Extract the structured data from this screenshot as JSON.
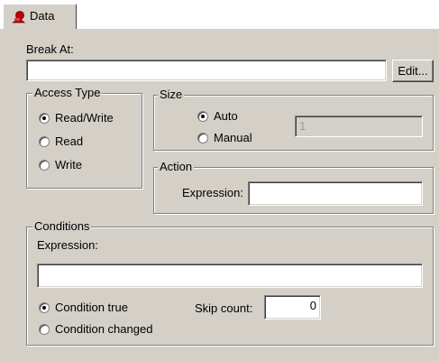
{
  "tab": {
    "label": "Data",
    "icon": "breakpoint-data-icon",
    "icon_color": "#c00000"
  },
  "break_at": {
    "label": "Break At:",
    "value": "",
    "edit_button": "Edit..."
  },
  "access_type": {
    "title": "Access Type",
    "options": [
      {
        "label": "Read/Write",
        "checked": true
      },
      {
        "label": "Read",
        "checked": false
      },
      {
        "label": "Write",
        "checked": false
      }
    ]
  },
  "size": {
    "title": "Size",
    "options": [
      {
        "label": "Auto",
        "checked": true
      },
      {
        "label": "Manual",
        "checked": false
      }
    ],
    "value": "1"
  },
  "action": {
    "title": "Action",
    "expression_label": "Expression:",
    "expression_value": ""
  },
  "conditions": {
    "title": "Conditions",
    "expression_label": "Expression:",
    "expression_value": "",
    "options": [
      {
        "label": "Condition true",
        "checked": true
      },
      {
        "label": "Condition changed",
        "checked": false
      }
    ],
    "skip_count_label": "Skip count:",
    "skip_count_value": "0"
  },
  "colors": {
    "dialog_bg": "#d4d0c8",
    "shadow": "#808080",
    "highlight": "#ffffff"
  }
}
